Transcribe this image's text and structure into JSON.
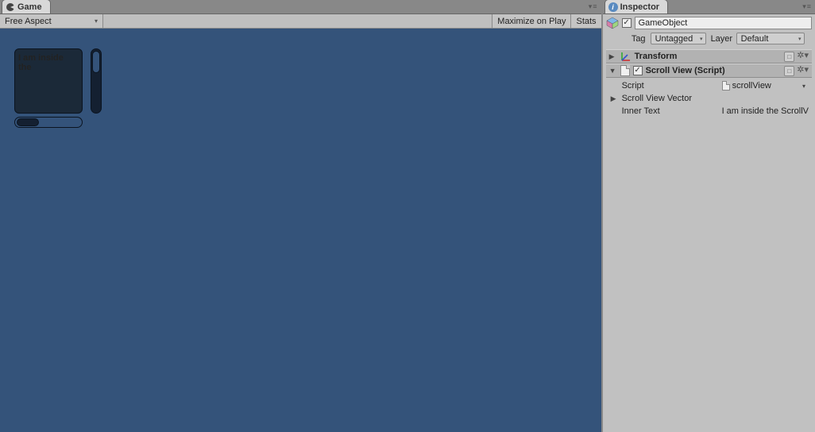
{
  "game": {
    "tab_title": "Game",
    "aspect": "Free Aspect",
    "maximize": "Maximize on Play",
    "stats": "Stats",
    "scrollview_text": "I am inside the"
  },
  "inspector": {
    "tab_title": "Inspector",
    "go_name": "GameObject",
    "tag_label": "Tag",
    "tag_value": "Untagged",
    "layer_label": "Layer",
    "layer_value": "Default",
    "components": {
      "transform": {
        "title": "Transform"
      },
      "scrollview": {
        "title": "Scroll View (Script)",
        "script_label": "Script",
        "script_value": "scrollView",
        "vector_label": "Scroll View Vector",
        "innertext_label": "Inner Text",
        "innertext_value": "I am inside the ScrollV"
      }
    }
  }
}
